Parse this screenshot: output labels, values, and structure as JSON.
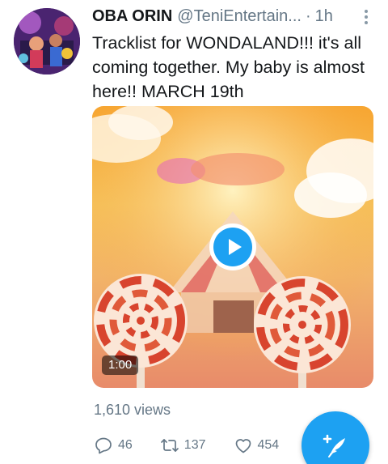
{
  "tweet": {
    "display_name": "OBA ORIN",
    "handle": "@TeniEntertain...",
    "separator": "·",
    "time": "1h",
    "text": "Tracklist for WONDALAND!!! it's all coming together. My baby is almost here!! MARCH 19th",
    "avatar_icon": "profile-avatar"
  },
  "media": {
    "type": "video",
    "duration": "1:00",
    "play_icon": "play-icon"
  },
  "stats": {
    "views": "1,610 views"
  },
  "actions": {
    "reply_count": "46",
    "retweet_count": "137",
    "like_count": "454"
  },
  "compose": {
    "icon": "compose-tweet-icon"
  },
  "colors": {
    "accent": "#1da1f2",
    "secondary_text": "#657786",
    "primary_text": "#14171a"
  }
}
